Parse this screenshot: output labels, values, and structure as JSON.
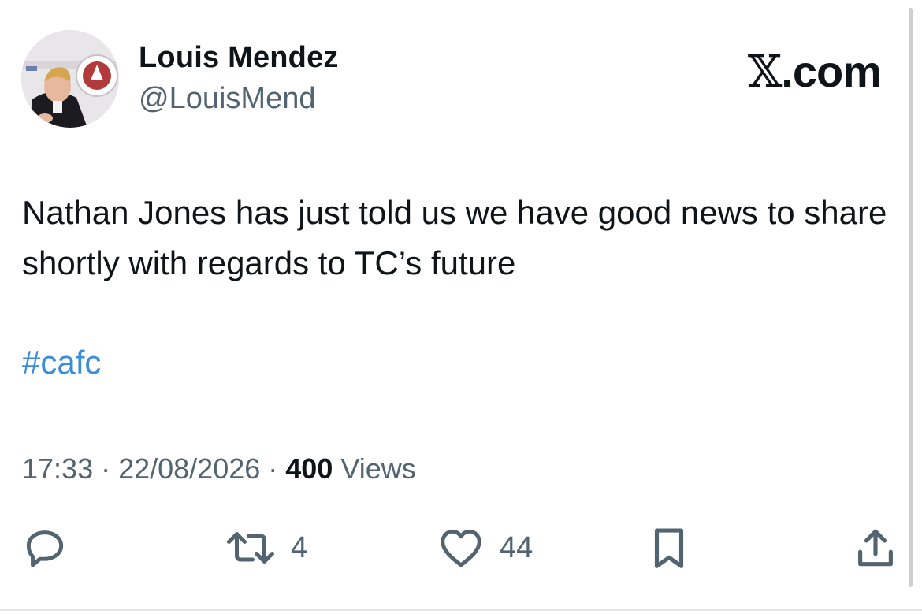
{
  "author": {
    "name": "Louis Mendez",
    "handle": "@LouisMend"
  },
  "brand": {
    "x_glyph": "𝕏",
    "suffix": ".com"
  },
  "tweet": {
    "text": "Nathan Jones has just told us we have good news to share shortly with regards to TC’s future",
    "hashtag": "#cafc"
  },
  "meta": {
    "time": "17:33",
    "separator": " · ",
    "date": "22/08/2026",
    "views_count": "400",
    "views_label": " Views"
  },
  "actions": {
    "reply": {
      "icon": "reply-icon",
      "count": ""
    },
    "retweet": {
      "icon": "retweet-icon",
      "count": "4"
    },
    "like": {
      "icon": "heart-icon",
      "count": "44"
    },
    "bookmark": {
      "icon": "bookmark-icon"
    },
    "share": {
      "icon": "share-icon"
    }
  },
  "colors": {
    "text": "#0f1419",
    "muted": "#536471",
    "link": "#3b8cd9"
  }
}
